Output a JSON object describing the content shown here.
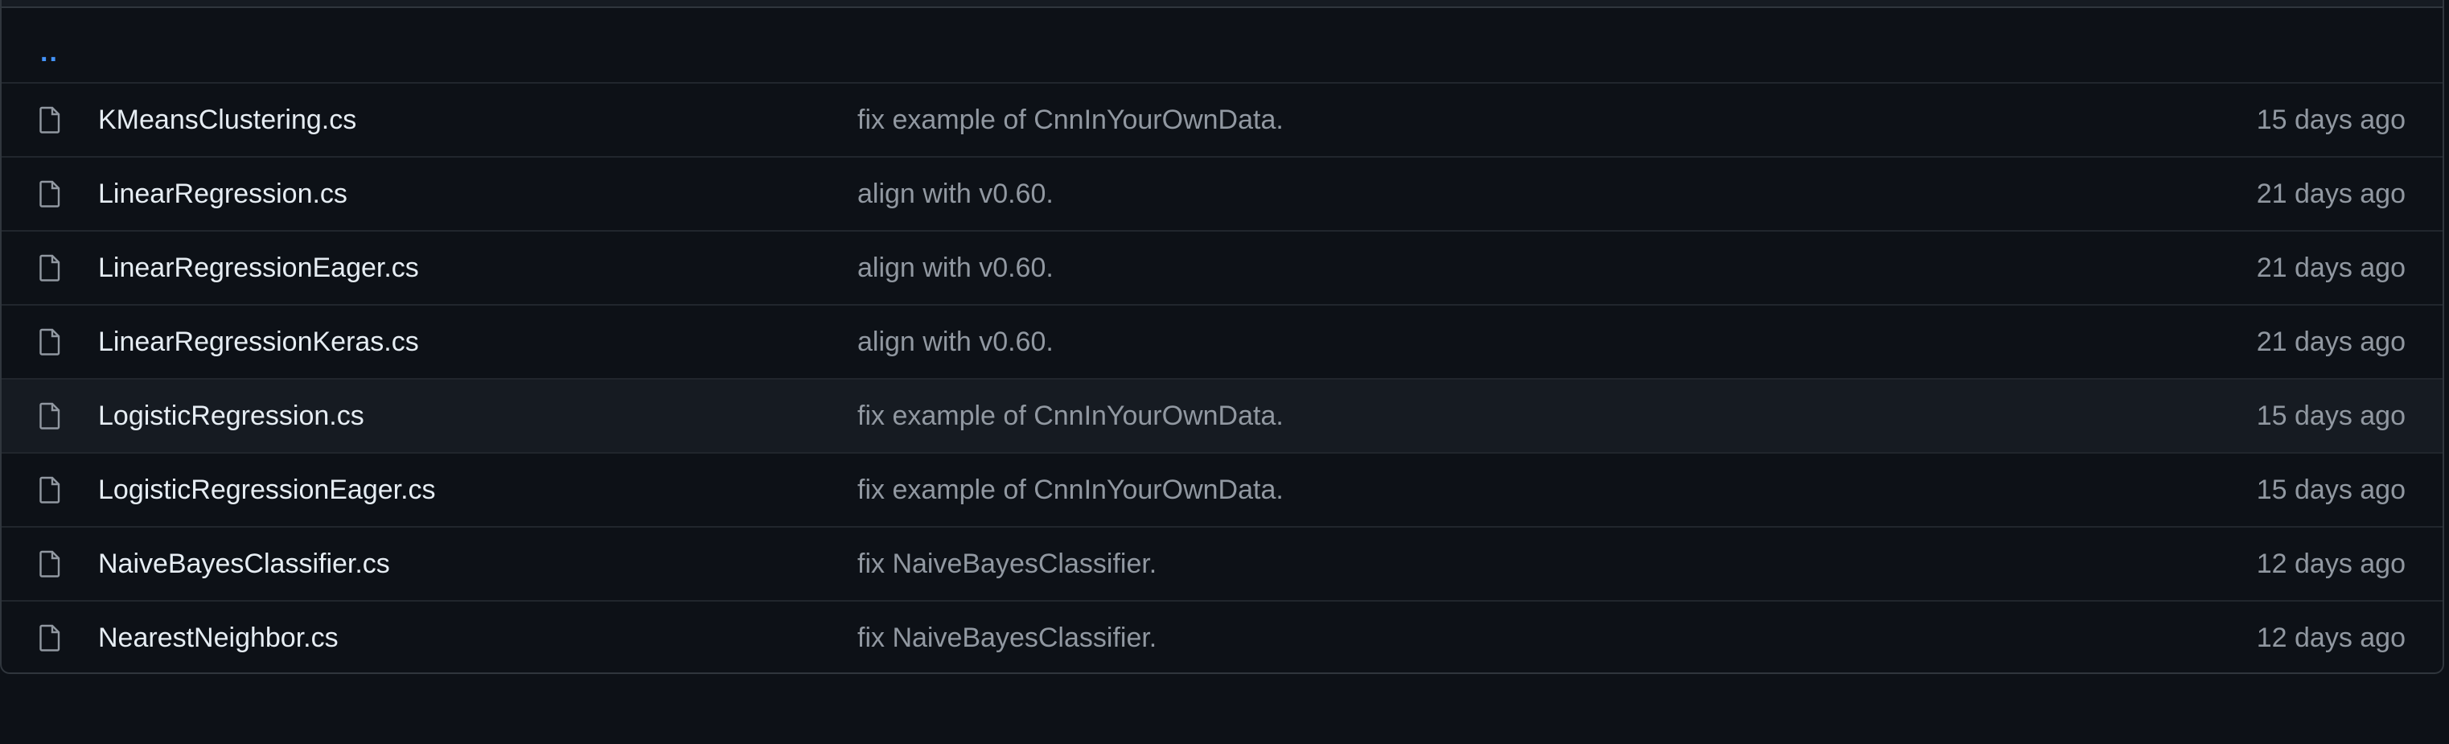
{
  "parent_link": "..",
  "files": [
    {
      "name": "KMeansClustering.cs",
      "message": "fix example of CnnInYourOwnData.",
      "age": "15 days ago"
    },
    {
      "name": "LinearRegression.cs",
      "message": "align with v0.60.",
      "age": "21 days ago"
    },
    {
      "name": "LinearRegressionEager.cs",
      "message": "align with v0.60.",
      "age": "21 days ago"
    },
    {
      "name": "LinearRegressionKeras.cs",
      "message": "align with v0.60.",
      "age": "21 days ago"
    },
    {
      "name": "LogisticRegression.cs",
      "message": "fix example of CnnInYourOwnData.",
      "age": "15 days ago"
    },
    {
      "name": "LogisticRegressionEager.cs",
      "message": "fix example of CnnInYourOwnData.",
      "age": "15 days ago"
    },
    {
      "name": "NaiveBayesClassifier.cs",
      "message": "fix NaiveBayesClassifier.",
      "age": "12 days ago"
    },
    {
      "name": "NearestNeighbor.cs",
      "message": "fix NaiveBayesClassifier.",
      "age": "12 days ago"
    }
  ],
  "icons": {
    "file": "file-icon"
  },
  "colors": {
    "background": "#0d1117",
    "border": "#30363d",
    "row_divider": "#21262d",
    "hover_row": "#161b22",
    "link": "#4493f8",
    "primary_text": "#e6edf3",
    "muted_text": "#9198a1"
  }
}
